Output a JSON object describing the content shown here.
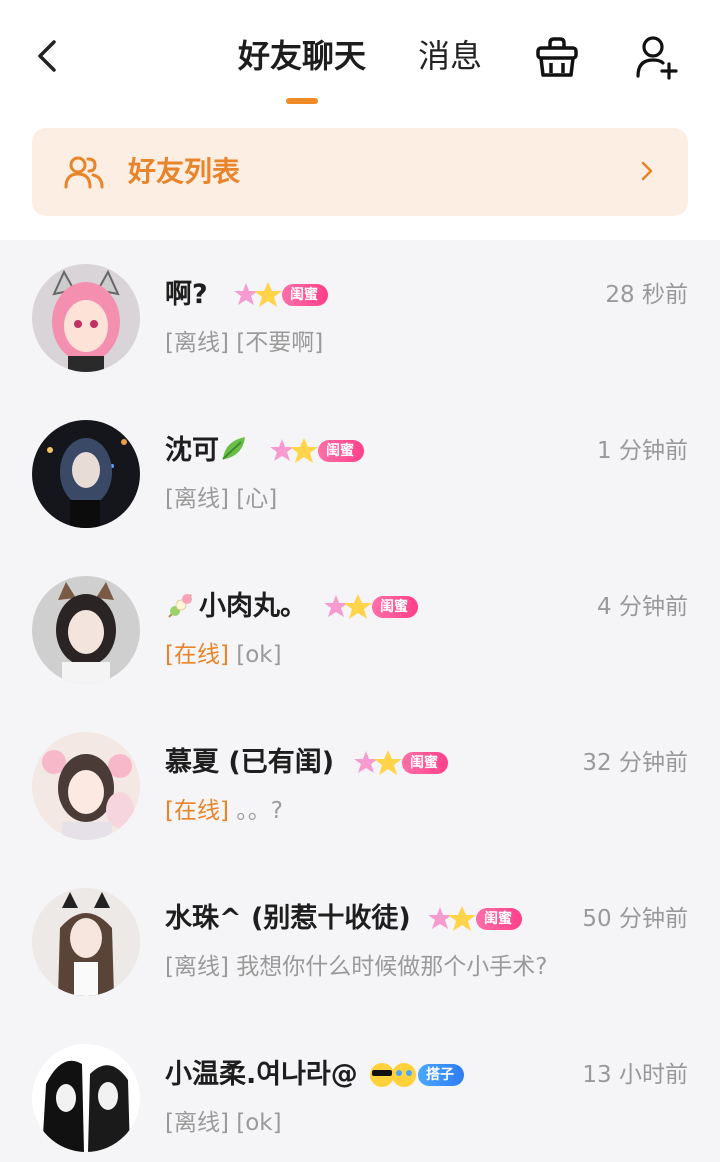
{
  "header": {
    "tabs": [
      {
        "label": "好友聊天",
        "active": true
      },
      {
        "label": "消息",
        "active": false
      }
    ],
    "accent": "#f08a24"
  },
  "friend_list": {
    "label": "好友列表"
  },
  "chats": [
    {
      "name": "啊?",
      "badge": "闺蜜",
      "time": "28 秒前",
      "status": "[离线]",
      "message": "[不要啊]"
    },
    {
      "name": "沈可",
      "badge": "闺蜜",
      "time": "1 分钟前",
      "status": "[离线]",
      "message": "[心]"
    },
    {
      "name": "小肉丸。",
      "badge": "闺蜜",
      "time": "4 分钟前",
      "status": "[在线]",
      "message": "[ok]"
    },
    {
      "name": "慕夏 (已有闺)",
      "badge": "闺蜜",
      "time": "32 分钟前",
      "status": "[在线]",
      "message": "。。?"
    },
    {
      "name": "水珠^ (别惹十收徒)",
      "badge": "闺蜜",
      "time": "50 分钟前",
      "status": "[离线]",
      "message": "我想你什么时候做那个小手术?"
    },
    {
      "name": "小温柔.여나라@",
      "badge": "搭子",
      "time": "13 小时前",
      "status": "[离线]",
      "message": "[ok]"
    }
  ],
  "colors": {
    "online": "#e8842a",
    "offline": "#9a9a9a",
    "badge_pink": "#ff4f93",
    "badge_blue": "#2e7df2"
  }
}
